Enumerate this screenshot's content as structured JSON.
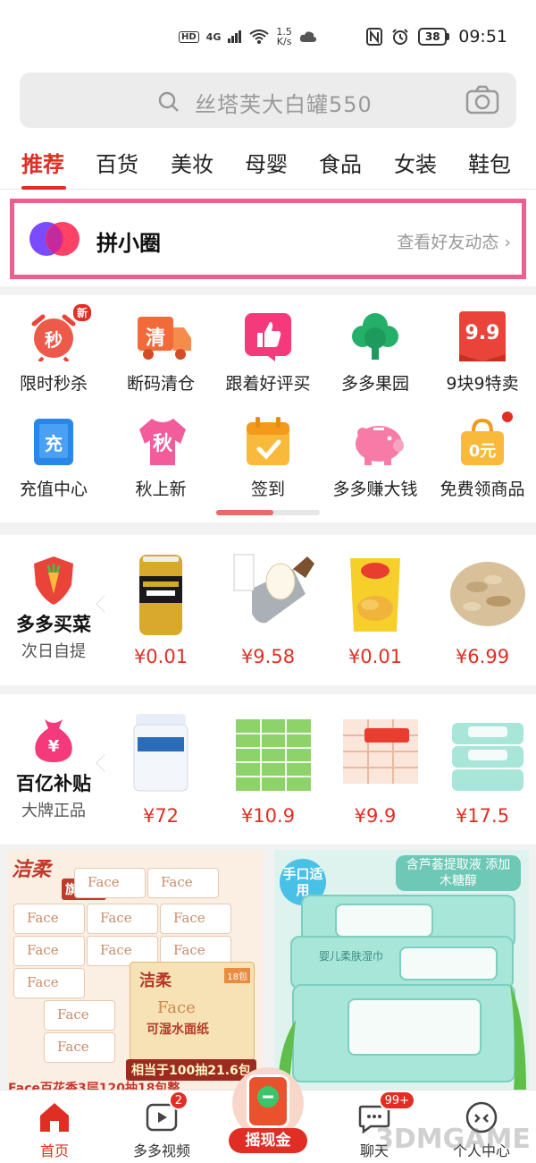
{
  "status_bar": {
    "hd": "HD",
    "network": "4G",
    "speed_value": "1.5",
    "speed_unit": "K/s",
    "battery": "38",
    "time": "09:51"
  },
  "search": {
    "placeholder": "丝塔芙大白罐550"
  },
  "tabs": [
    "推荐",
    "百货",
    "美妆",
    "母婴",
    "食品",
    "女装",
    "鞋包"
  ],
  "circle": {
    "title": "拼小圈",
    "link": "查看好友动态"
  },
  "grid": {
    "items": [
      {
        "label": "限时秒杀",
        "icon": "alarm-clock-icon",
        "badge": "新",
        "glyph": "秒"
      },
      {
        "label": "断码清仓",
        "icon": "truck-icon",
        "glyph": "清"
      },
      {
        "label": "跟着好评买",
        "icon": "thumbs-up-icon"
      },
      {
        "label": "多多果园",
        "icon": "tree-icon"
      },
      {
        "label": "9块9特卖",
        "icon": "price-tag-icon",
        "glyph": "9.9"
      },
      {
        "label": "充值中心",
        "icon": "phone-icon",
        "glyph": "充"
      },
      {
        "label": "秋上新",
        "icon": "shirt-icon",
        "glyph": "秋"
      },
      {
        "label": "签到",
        "icon": "calendar-check-icon"
      },
      {
        "label": "多多赚大钱",
        "icon": "piggy-bank-icon"
      },
      {
        "label": "免费领商品",
        "icon": "shopping-bag-icon",
        "glyph": "0元"
      }
    ]
  },
  "grocery": {
    "title": "多多买菜",
    "subtitle": "次日自提",
    "products": [
      {
        "price": "¥0.01",
        "name": "energy-drink-can"
      },
      {
        "price": "¥9.58",
        "name": "kitchen-knife"
      },
      {
        "price": "¥0.01",
        "name": "potato-chips-bag"
      },
      {
        "price": "¥6.99",
        "name": "dried-shrimp"
      }
    ]
  },
  "subsidy": {
    "title": "百亿补贴",
    "subtitle": "大牌正品",
    "products": [
      {
        "price": "¥72",
        "name": "cetaphil-cream"
      },
      {
        "price": "¥10.9",
        "name": "tissue-pack"
      },
      {
        "price": "¥9.9",
        "name": "face-tissue-pack"
      },
      {
        "price": "¥17.5",
        "name": "baby-wipes"
      }
    ]
  },
  "banner_left": {
    "brand": "洁柔",
    "store": "旗舰店",
    "tissue_label": "Face",
    "box_brand": "洁柔",
    "box_face": "Face",
    "box_cn": "可湿水面纸",
    "box_count": "18包",
    "deal": "相当于100抽21.6包",
    "caption": "Face百花香3层120抽18包整"
  },
  "banner_right": {
    "tag": "手口适用",
    "headline": "含芦荟提取液 添加木糖醇",
    "product_text": "婴儿柔肤湿巾"
  },
  "bottom_nav": {
    "home": "首页",
    "video": "多多视频",
    "video_count": "2",
    "cash": "摇现金",
    "chat": "聊天",
    "chat_count": "99+",
    "me": "个人中心"
  },
  "watermark": "3DMGAME",
  "colors": {
    "brand_red": "#e02e24",
    "highlight_pink": "#ec5f8e"
  }
}
